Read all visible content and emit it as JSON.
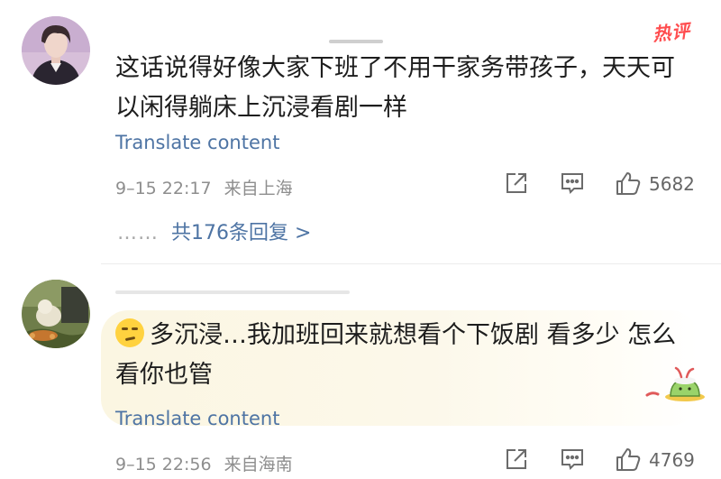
{
  "comments": [
    {
      "username": "",
      "hot_badge": "热评",
      "text": "这话说得好像大家下班了不用干家务带孩子，天天可以闲得躺床上沉浸看剧一样",
      "translate": "Translate content",
      "time": "9–15 22:17",
      "location": "来自上海",
      "likes": "5682",
      "replies_dots": "……",
      "replies_text": "共176条回复 >"
    },
    {
      "username": "",
      "text": "多沉浸…我加班回来就想看个下饭剧 看多少 怎么看你也管",
      "translate": "Translate content",
      "time": "9–15 22:56",
      "location": "来自海南",
      "likes": "4769"
    }
  ],
  "icons": [
    "share-icon",
    "comment-icon",
    "thumbs-up-icon",
    "emoji-icon",
    "pudding-sticker-icon"
  ],
  "colors": {
    "link": "#4e74a4",
    "hot": "#ff4d4f",
    "meta": "#8e8e8e",
    "bubble": "#fbf6e2"
  }
}
